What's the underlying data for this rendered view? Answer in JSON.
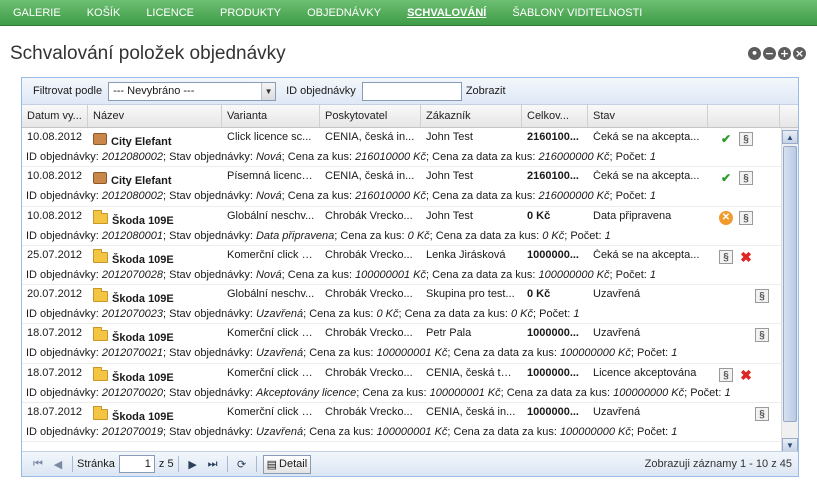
{
  "nav": {
    "items": [
      "GALERIE",
      "KOŠÍK",
      "LICENCE",
      "PRODUKTY",
      "OBJEDNÁVKY",
      "SCHVALOVÁNÍ",
      "ŠABLONY VIDITELNOSTI"
    ],
    "active_index": 5
  },
  "page": {
    "title": "Schvalování položek objednávky",
    "window_controls": [
      "more-icon",
      "minimize-icon",
      "add-icon",
      "close-icon"
    ]
  },
  "filter": {
    "label": "Filtrovat podle",
    "select_value": "--- Nevybráno ---",
    "order_id_label": "ID objednávky",
    "order_id_value": "",
    "show_button": "Zobrazit"
  },
  "grid": {
    "columns": [
      "Datum vy...",
      "Název",
      "Varianta",
      "Poskytovatel",
      "Zákazník",
      "Celkov...",
      "Stav"
    ],
    "rows": [
      {
        "date": "10.08.2012",
        "icon": "box-icon",
        "name": "City Elefant",
        "variant": "Click licence sc...",
        "provider": "CENIA, česká in...",
        "customer": "John Test",
        "total": "2160100...",
        "status": "Čeká se na akcepta...",
        "actions": [
          "approve",
          "paragraph-reject"
        ],
        "detail": {
          "id": "2012080002",
          "state": "Nová",
          "price": "216010000 Kč",
          "data_price": "216000000 Kč",
          "count": "1"
        }
      },
      {
        "date": "10.08.2012",
        "icon": "box-icon",
        "name": "City Elefant",
        "variant": "Písemná licence...",
        "provider": "CENIA, česká in...",
        "customer": "John Test",
        "total": "2160100...",
        "status": "Čeká se na akcepta...",
        "actions": [
          "approve",
          "paragraph-reject"
        ],
        "detail": {
          "id": "2012080002",
          "state": "Nová",
          "price": "216010000 Kč",
          "data_price": "216000000 Kč",
          "count": "1"
        }
      },
      {
        "date": "10.08.2012",
        "icon": "folder-icon",
        "name": "Škoda 109E",
        "variant": "Globální neschv...",
        "provider": "Chrobák Vrecko...",
        "customer": "John Test",
        "total": "0 Kč",
        "status": "Data připravena",
        "actions": [
          "cancel",
          "paragraph"
        ],
        "detail": {
          "id": "2012080001",
          "state": "Data připravena",
          "price": "0 Kč",
          "data_price": "0 Kč",
          "count": "1"
        }
      },
      {
        "date": "25.07.2012",
        "icon": "folder-icon",
        "name": "Škoda 109E",
        "variant": "Komerční click li...",
        "provider": "Chrobák Vrecko...",
        "customer": "Lenka Jirásková",
        "total": "1000000...",
        "status": "Čeká se na akcepta...",
        "actions": [
          "paragraph",
          "reject"
        ],
        "detail": {
          "id": "2012070028",
          "state": "Nová",
          "price": "100000001 Kč",
          "data_price": "100000000 Kč",
          "count": "1"
        }
      },
      {
        "date": "20.07.2012",
        "icon": "folder-icon",
        "name": "Škoda 109E",
        "variant": "Globální neschv...",
        "provider": "Chrobák Vrecko...",
        "customer": "Skupina pro test...",
        "total": "0 Kč",
        "status": "Uzavřená",
        "actions": [
          "paragraph"
        ],
        "detail": {
          "id": "2012070023",
          "state": "Uzavřená",
          "price": "0 Kč",
          "data_price": "0 Kč",
          "count": "1"
        }
      },
      {
        "date": "18.07.2012",
        "icon": "folder-icon",
        "name": "Škoda 109E",
        "variant": "Komerční click li...",
        "provider": "Chrobák Vrecko...",
        "customer": "Petr Pala",
        "total": "1000000...",
        "status": "Uzavřená",
        "actions": [
          "paragraph"
        ],
        "detail": {
          "id": "2012070021",
          "state": "Uzavřená",
          "price": "100000001 Kč",
          "data_price": "100000000 Kč",
          "count": "1"
        }
      },
      {
        "date": "18.07.2012",
        "icon": "folder-icon",
        "name": "Škoda 109E",
        "variant": "Komerční click li...",
        "provider": "Chrobák Vrecko...",
        "customer": "CENIA, česká test...",
        "total": "1000000...",
        "status": "Licence akceptována",
        "actions": [
          "paragraph",
          "reject"
        ],
        "detail": {
          "id": "2012070020",
          "state": "Akceptovány licence",
          "price": "100000001 Kč",
          "data_price": "100000000 Kč",
          "count": "1"
        }
      },
      {
        "date": "18.07.2012",
        "icon": "folder-icon",
        "name": "Škoda 109E",
        "variant": "Komerční click li...",
        "provider": "Chrobák Vrecko...",
        "customer": "CENIA, česká in...",
        "total": "1000000...",
        "status": "Uzavřená",
        "actions": [
          "paragraph"
        ],
        "detail": {
          "id": "2012070019",
          "state": "Uzavřená",
          "price": "100000001 Kč",
          "data_price": "100000000 Kč",
          "count": "1"
        }
      }
    ],
    "detail_labels": {
      "id": "ID objednávky:",
      "state": "Stav objednávky:",
      "price": "Cena za kus:",
      "data_price": "Cena za data za kus:",
      "count": "Počet:"
    }
  },
  "pager": {
    "page_label": "Stránka",
    "page_value": "1",
    "of_label": "z 5",
    "detail_button": "Detail",
    "summary": "Zobrazuji záznamy 1 - 10 z 45"
  }
}
